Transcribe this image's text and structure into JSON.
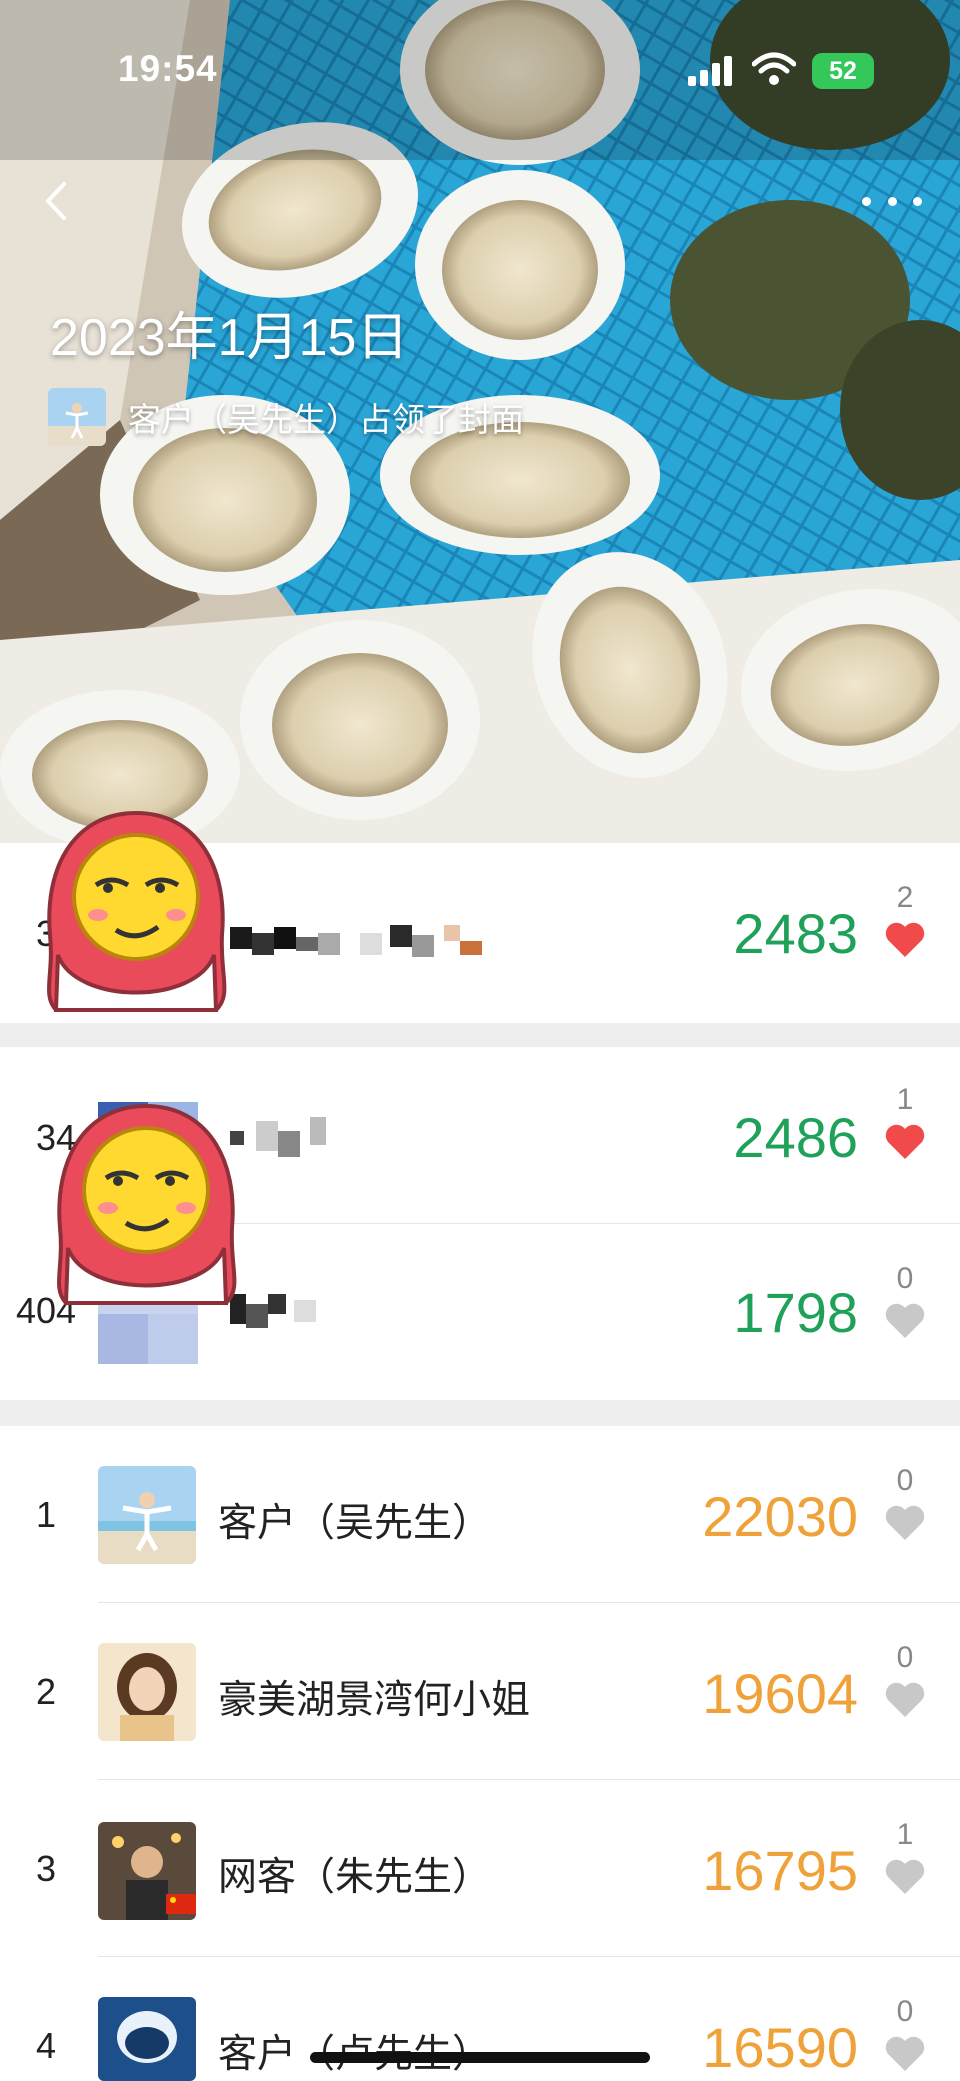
{
  "status_bar": {
    "time": "19:54",
    "battery": "52"
  },
  "cover": {
    "date": "2023年1月15日",
    "caption": "客户（吴先生）占领了封面"
  },
  "friends": [
    {
      "rank": "3",
      "steps": "2483",
      "likes": "2",
      "liked": true
    },
    {
      "rank": "34",
      "steps": "2486",
      "likes": "1",
      "liked": true
    },
    {
      "rank": "404",
      "steps": "1798",
      "likes": "0",
      "liked": false
    }
  ],
  "ranking": [
    {
      "rank": "1",
      "name": "客户（吴先生）",
      "steps": "22030",
      "likes": "0"
    },
    {
      "rank": "2",
      "name": "豪美湖景湾何小姐",
      "steps": "19604",
      "likes": "0"
    },
    {
      "rank": "3",
      "name": "网客（朱先生）",
      "steps": "16795",
      "likes": "1"
    },
    {
      "rank": "4",
      "name": "客户（卢先生）",
      "steps": "16590",
      "likes": "0"
    }
  ],
  "colors": {
    "green": "#1fa15a",
    "orange": "#f0a23a",
    "heart_active": "#f04a4a",
    "heart_inactive": "#c8c8c8"
  },
  "icons": [
    "chevron-left-icon",
    "more-dots-icon",
    "signal-icon",
    "wifi-icon",
    "heart-icon"
  ]
}
